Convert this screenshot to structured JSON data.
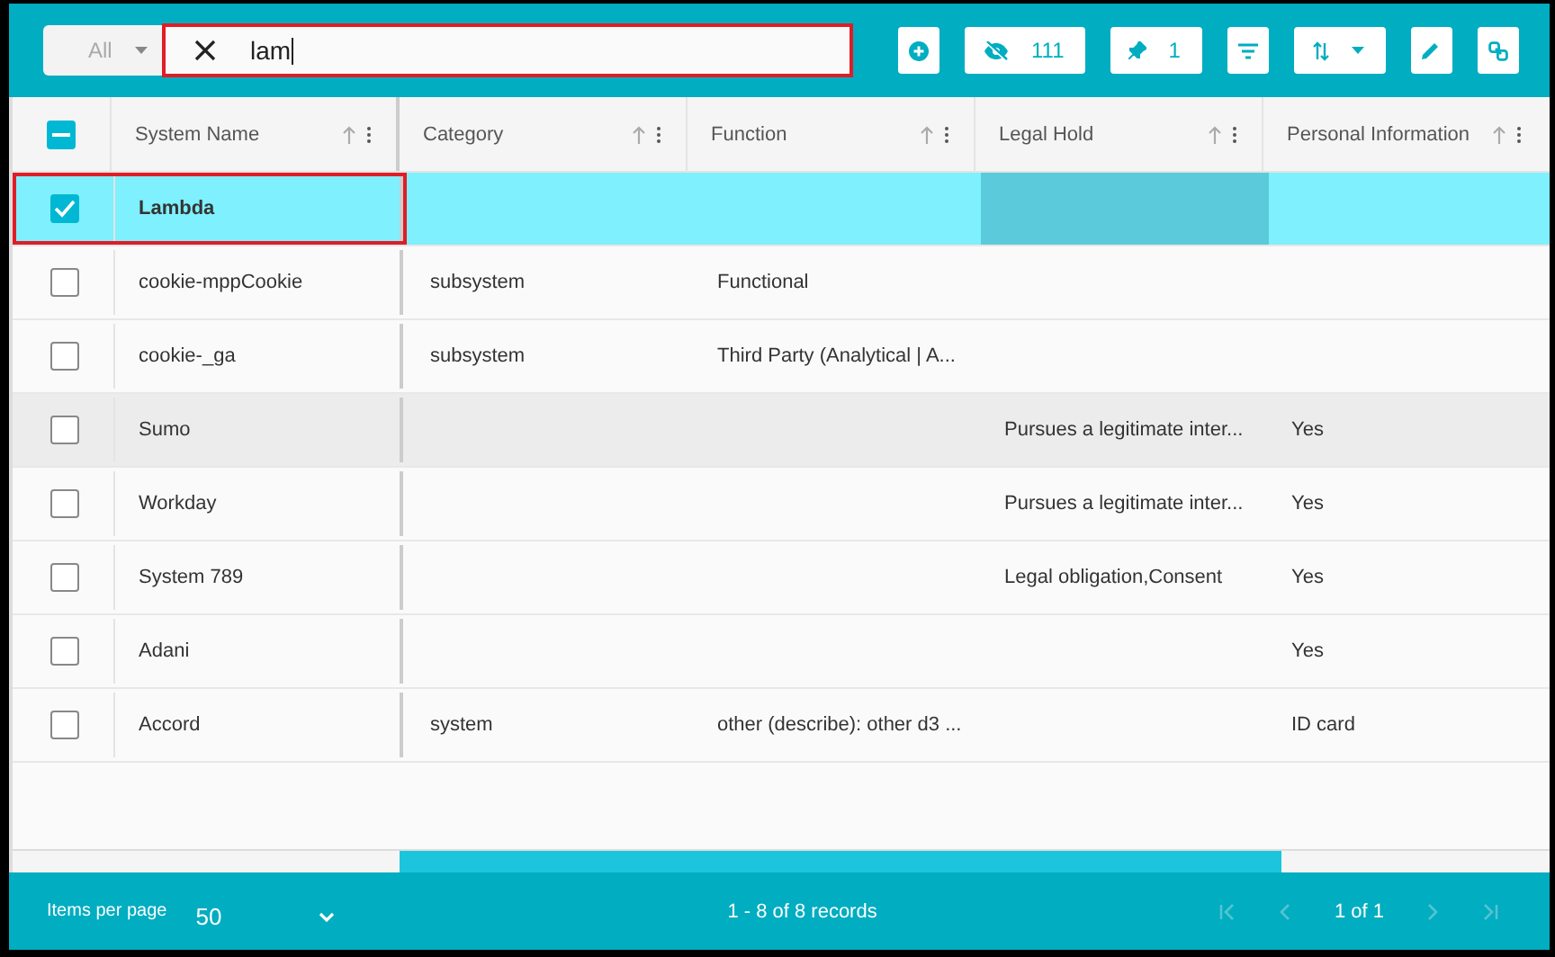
{
  "filter": {
    "label": "All"
  },
  "search": {
    "value": "lam",
    "annotated": true
  },
  "toolbar": [
    {
      "kind": "add"
    },
    {
      "kind": "hidden",
      "label": "111"
    },
    {
      "kind": "pin",
      "label": "1"
    },
    {
      "kind": "filter"
    },
    {
      "kind": "sort"
    },
    {
      "kind": "edit"
    },
    {
      "kind": "link"
    }
  ],
  "header_checkbox": {
    "indeterminate": true
  },
  "columns": [
    "System Name",
    "Category",
    "Function",
    "Legal Hold",
    "Personal Information"
  ],
  "rows": [
    {
      "selected": true,
      "hovered": false,
      "annotated": true,
      "cells": [
        "Lambda",
        "",
        "",
        "",
        ""
      ]
    },
    {
      "selected": false,
      "hovered": false,
      "annotated": false,
      "cells": [
        "cookie-mppCookie",
        "subsystem",
        "Functional",
        "",
        ""
      ]
    },
    {
      "selected": false,
      "hovered": false,
      "annotated": false,
      "cells": [
        "cookie-_ga",
        "subsystem",
        "Third Party (Analytical | A...",
        "",
        ""
      ]
    },
    {
      "selected": false,
      "hovered": true,
      "annotated": false,
      "cells": [
        "Sumo",
        "",
        "",
        "Pursues a legitimate inter...",
        "Yes"
      ]
    },
    {
      "selected": false,
      "hovered": false,
      "annotated": false,
      "cells": [
        "Workday",
        "",
        "",
        "Pursues a legitimate inter...",
        "Yes"
      ]
    },
    {
      "selected": false,
      "hovered": false,
      "annotated": false,
      "cells": [
        "System 789",
        "",
        "",
        "Legal obligation,Consent",
        "Yes"
      ]
    },
    {
      "selected": false,
      "hovered": false,
      "annotated": false,
      "cells": [
        "Adani",
        "",
        "",
        "",
        "Yes"
      ]
    },
    {
      "selected": false,
      "hovered": false,
      "annotated": false,
      "cells": [
        "Accord",
        "system",
        "other (describe): other d3 ...",
        "",
        "ID card"
      ]
    }
  ],
  "footer": {
    "items_per_page_label": "Items per page",
    "items_per_page": "50",
    "records": "1 - 8 of 8 records",
    "page": "1 of 1",
    "prev_disabled": true,
    "next_disabled": true
  }
}
